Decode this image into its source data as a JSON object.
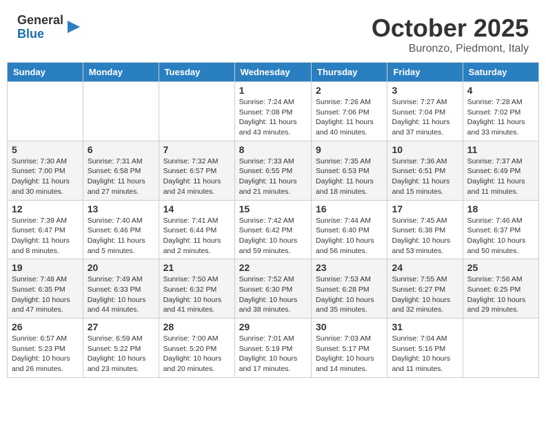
{
  "header": {
    "logo": {
      "line1": "General",
      "line2": "Blue"
    },
    "month": "October 2025",
    "location": "Buronzo, Piedmont, Italy"
  },
  "weekdays": [
    "Sunday",
    "Monday",
    "Tuesday",
    "Wednesday",
    "Thursday",
    "Friday",
    "Saturday"
  ],
  "weeks": [
    [
      {
        "day": "",
        "info": ""
      },
      {
        "day": "",
        "info": ""
      },
      {
        "day": "",
        "info": ""
      },
      {
        "day": "1",
        "info": "Sunrise: 7:24 AM\nSunset: 7:08 PM\nDaylight: 11 hours\nand 43 minutes."
      },
      {
        "day": "2",
        "info": "Sunrise: 7:26 AM\nSunset: 7:06 PM\nDaylight: 11 hours\nand 40 minutes."
      },
      {
        "day": "3",
        "info": "Sunrise: 7:27 AM\nSunset: 7:04 PM\nDaylight: 11 hours\nand 37 minutes."
      },
      {
        "day": "4",
        "info": "Sunrise: 7:28 AM\nSunset: 7:02 PM\nDaylight: 11 hours\nand 33 minutes."
      }
    ],
    [
      {
        "day": "5",
        "info": "Sunrise: 7:30 AM\nSunset: 7:00 PM\nDaylight: 11 hours\nand 30 minutes."
      },
      {
        "day": "6",
        "info": "Sunrise: 7:31 AM\nSunset: 6:58 PM\nDaylight: 11 hours\nand 27 minutes."
      },
      {
        "day": "7",
        "info": "Sunrise: 7:32 AM\nSunset: 6:57 PM\nDaylight: 11 hours\nand 24 minutes."
      },
      {
        "day": "8",
        "info": "Sunrise: 7:33 AM\nSunset: 6:55 PM\nDaylight: 11 hours\nand 21 minutes."
      },
      {
        "day": "9",
        "info": "Sunrise: 7:35 AM\nSunset: 6:53 PM\nDaylight: 11 hours\nand 18 minutes."
      },
      {
        "day": "10",
        "info": "Sunrise: 7:36 AM\nSunset: 6:51 PM\nDaylight: 11 hours\nand 15 minutes."
      },
      {
        "day": "11",
        "info": "Sunrise: 7:37 AM\nSunset: 6:49 PM\nDaylight: 11 hours\nand 11 minutes."
      }
    ],
    [
      {
        "day": "12",
        "info": "Sunrise: 7:39 AM\nSunset: 6:47 PM\nDaylight: 11 hours\nand 8 minutes."
      },
      {
        "day": "13",
        "info": "Sunrise: 7:40 AM\nSunset: 6:46 PM\nDaylight: 11 hours\nand 5 minutes."
      },
      {
        "day": "14",
        "info": "Sunrise: 7:41 AM\nSunset: 6:44 PM\nDaylight: 11 hours\nand 2 minutes."
      },
      {
        "day": "15",
        "info": "Sunrise: 7:42 AM\nSunset: 6:42 PM\nDaylight: 10 hours\nand 59 minutes."
      },
      {
        "day": "16",
        "info": "Sunrise: 7:44 AM\nSunset: 6:40 PM\nDaylight: 10 hours\nand 56 minutes."
      },
      {
        "day": "17",
        "info": "Sunrise: 7:45 AM\nSunset: 6:38 PM\nDaylight: 10 hours\nand 53 minutes."
      },
      {
        "day": "18",
        "info": "Sunrise: 7:46 AM\nSunset: 6:37 PM\nDaylight: 10 hours\nand 50 minutes."
      }
    ],
    [
      {
        "day": "19",
        "info": "Sunrise: 7:48 AM\nSunset: 6:35 PM\nDaylight: 10 hours\nand 47 minutes."
      },
      {
        "day": "20",
        "info": "Sunrise: 7:49 AM\nSunset: 6:33 PM\nDaylight: 10 hours\nand 44 minutes."
      },
      {
        "day": "21",
        "info": "Sunrise: 7:50 AM\nSunset: 6:32 PM\nDaylight: 10 hours\nand 41 minutes."
      },
      {
        "day": "22",
        "info": "Sunrise: 7:52 AM\nSunset: 6:30 PM\nDaylight: 10 hours\nand 38 minutes."
      },
      {
        "day": "23",
        "info": "Sunrise: 7:53 AM\nSunset: 6:28 PM\nDaylight: 10 hours\nand 35 minutes."
      },
      {
        "day": "24",
        "info": "Sunrise: 7:55 AM\nSunset: 6:27 PM\nDaylight: 10 hours\nand 32 minutes."
      },
      {
        "day": "25",
        "info": "Sunrise: 7:56 AM\nSunset: 6:25 PM\nDaylight: 10 hours\nand 29 minutes."
      }
    ],
    [
      {
        "day": "26",
        "info": "Sunrise: 6:57 AM\nSunset: 5:23 PM\nDaylight: 10 hours\nand 26 minutes."
      },
      {
        "day": "27",
        "info": "Sunrise: 6:59 AM\nSunset: 5:22 PM\nDaylight: 10 hours\nand 23 minutes."
      },
      {
        "day": "28",
        "info": "Sunrise: 7:00 AM\nSunset: 5:20 PM\nDaylight: 10 hours\nand 20 minutes."
      },
      {
        "day": "29",
        "info": "Sunrise: 7:01 AM\nSunset: 5:19 PM\nDaylight: 10 hours\nand 17 minutes."
      },
      {
        "day": "30",
        "info": "Sunrise: 7:03 AM\nSunset: 5:17 PM\nDaylight: 10 hours\nand 14 minutes."
      },
      {
        "day": "31",
        "info": "Sunrise: 7:04 AM\nSunset: 5:16 PM\nDaylight: 10 hours\nand 11 minutes."
      },
      {
        "day": "",
        "info": ""
      }
    ]
  ]
}
